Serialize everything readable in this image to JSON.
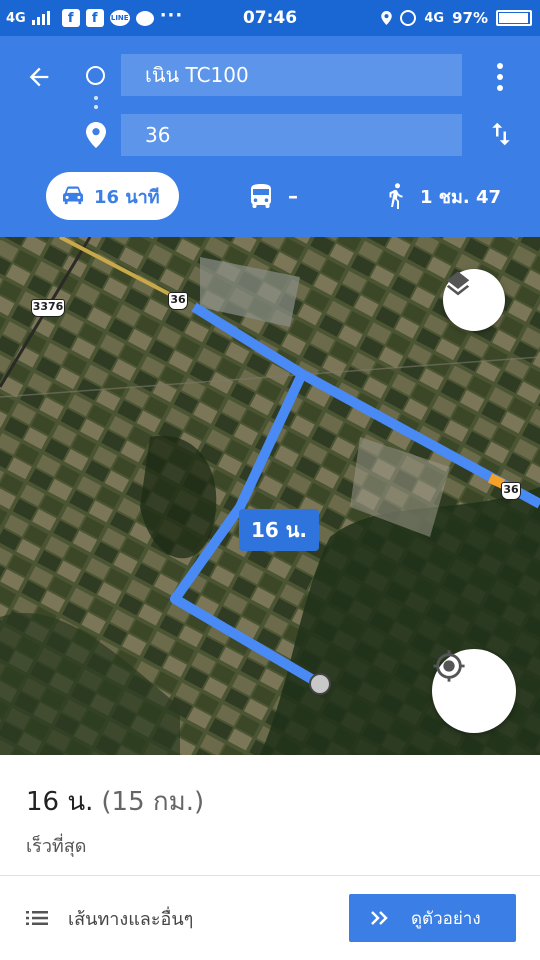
{
  "status_bar": {
    "network_left": "4G",
    "time": "07:46",
    "network_right": "4G",
    "battery": "97%",
    "notification_icons": [
      "facebook-icon",
      "facebook-icon",
      "line-icon",
      "chat-bubble-icon",
      "more-dots-icon"
    ]
  },
  "directions": {
    "origin": "เนิน TC100",
    "destination": "36"
  },
  "modes": {
    "drive": "16 นาที",
    "transit": "–",
    "walk": "1 ชม. 47"
  },
  "map": {
    "road_shields": [
      "3376",
      "36",
      "36"
    ],
    "duration_label": "16 น."
  },
  "summary": {
    "duration": "16 น.",
    "distance": "(15 กม.)",
    "subtitle": "เร็วที่สุด"
  },
  "actions": {
    "routes_label": "เส้นทางและอื่นๆ",
    "preview_label": "ดูตัวอย่าง"
  },
  "colors": {
    "header": "#3a7ee6",
    "status_bar": "#1a66d2",
    "route": "#4a8af4"
  }
}
